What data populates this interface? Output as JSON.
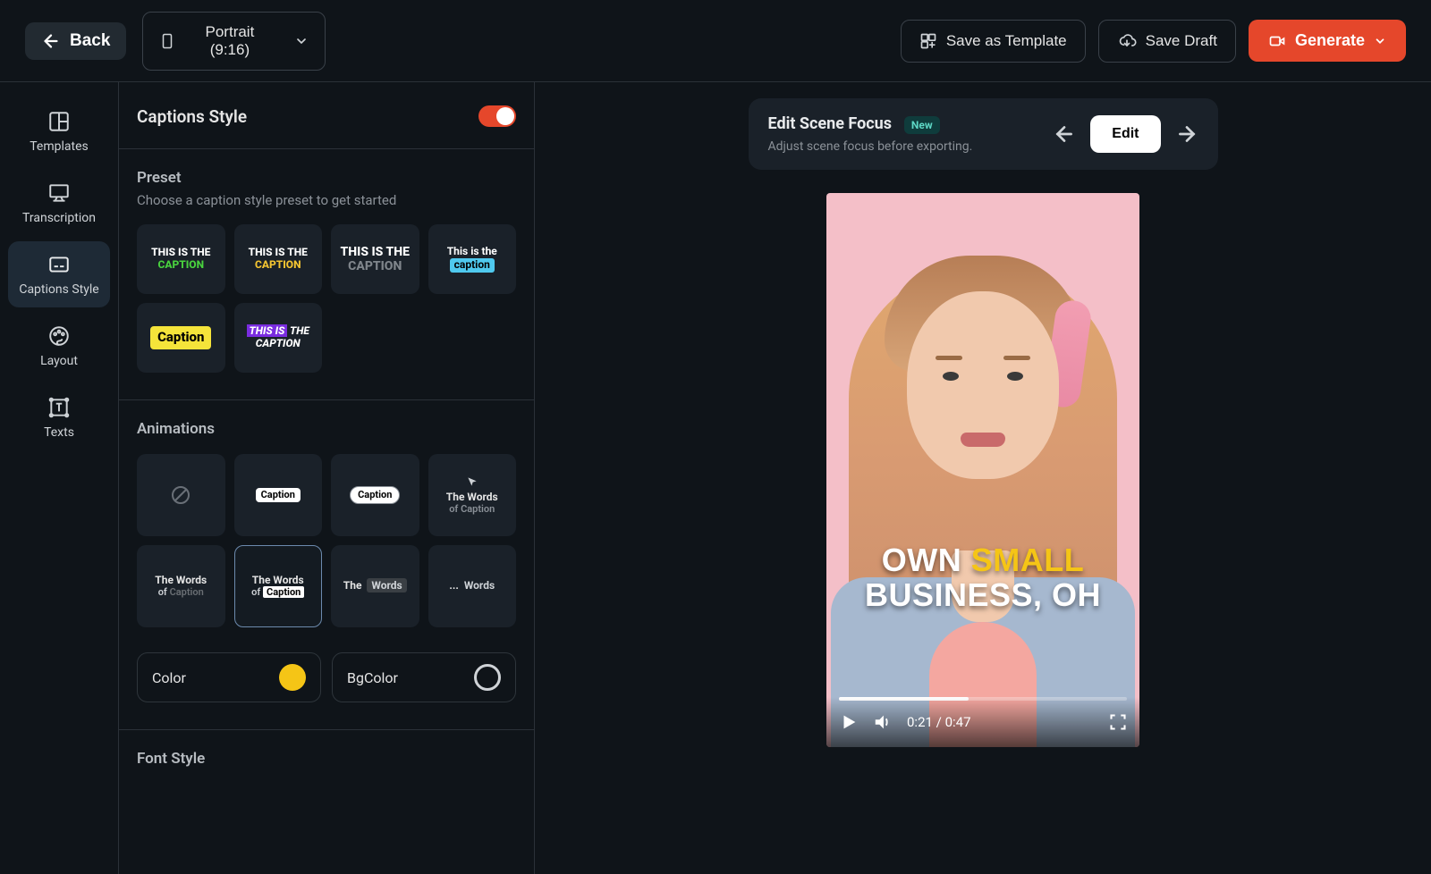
{
  "topbar": {
    "back_label": "Back",
    "aspect_label": "Portrait (9:16)",
    "save_template_label": "Save as Template",
    "save_draft_label": "Save Draft",
    "generate_label": "Generate"
  },
  "sidebar": {
    "items": [
      {
        "label": "Templates"
      },
      {
        "label": "Transcription"
      },
      {
        "label": "Captions Style"
      },
      {
        "label": "Layout"
      },
      {
        "label": "Texts"
      }
    ],
    "active_index": 2
  },
  "panel": {
    "title": "Captions Style",
    "toggle_on": true,
    "preset": {
      "heading": "Preset",
      "sub": "Choose a caption style preset to get started",
      "tiles": [
        {
          "line1": "THIS IS THE",
          "line2": "CAPTION",
          "l1_color": "#ffffff",
          "l2_color": "#49d23e"
        },
        {
          "line1": "THIS IS THE",
          "line2": "CAPTION",
          "l1_color": "#ffffff",
          "l2_color": "#f3c431"
        },
        {
          "line1": "THIS IS THE",
          "line2": "CAPTION",
          "l1_color": "#ffffff",
          "l2_color": "#7f858b"
        },
        {
          "line1": "This is the",
          "line2": "caption",
          "l1_color": "#ffffff",
          "l2_bg": "#4fc9ee",
          "l2_color": "#000000"
        },
        {
          "pill": "Caption",
          "pill_bg": "#f5e43a",
          "pill_color": "#000000"
        },
        {
          "line1": "THIS IS",
          "line1_bg": "#7a2ce0",
          "line1b": " THE",
          "line2": "CAPTION",
          "l1_color": "#ffffff",
          "l2_color": "#ffffff",
          "italic": true
        }
      ]
    },
    "animations": {
      "heading": "Animations",
      "tiles": [
        {
          "type": "none"
        },
        {
          "type": "pill",
          "text": "Caption"
        },
        {
          "type": "pill_round",
          "text": "Caption"
        },
        {
          "type": "words_cursor",
          "l1": "The Words",
          "l2": "of Caption"
        },
        {
          "type": "words_fade",
          "l1": "The Words",
          "l2": "of Caption"
        },
        {
          "type": "words_highlight",
          "l1": "The  Words",
          "l2": "of Caption",
          "selected": true
        },
        {
          "type": "words_spaced",
          "text": "The  Words"
        },
        {
          "type": "words_ellipsis",
          "text": "...  Words"
        }
      ],
      "color_label": "Color",
      "bgcolor_label": "BgColor",
      "color_value": "#f5c516",
      "bgcolor_value": "transparent"
    },
    "font_style_heading": "Font Style"
  },
  "scene_focus": {
    "title": "Edit Scene Focus",
    "badge": "New",
    "desc": "Adjust scene focus before exporting.",
    "edit_label": "Edit"
  },
  "preview": {
    "caption_words": [
      "OWN",
      "SMALL",
      "BUSINESS,",
      "OH"
    ],
    "highlight_index": 1,
    "time_current": "0:21",
    "time_total": "0:47",
    "progress_pct": 45
  }
}
